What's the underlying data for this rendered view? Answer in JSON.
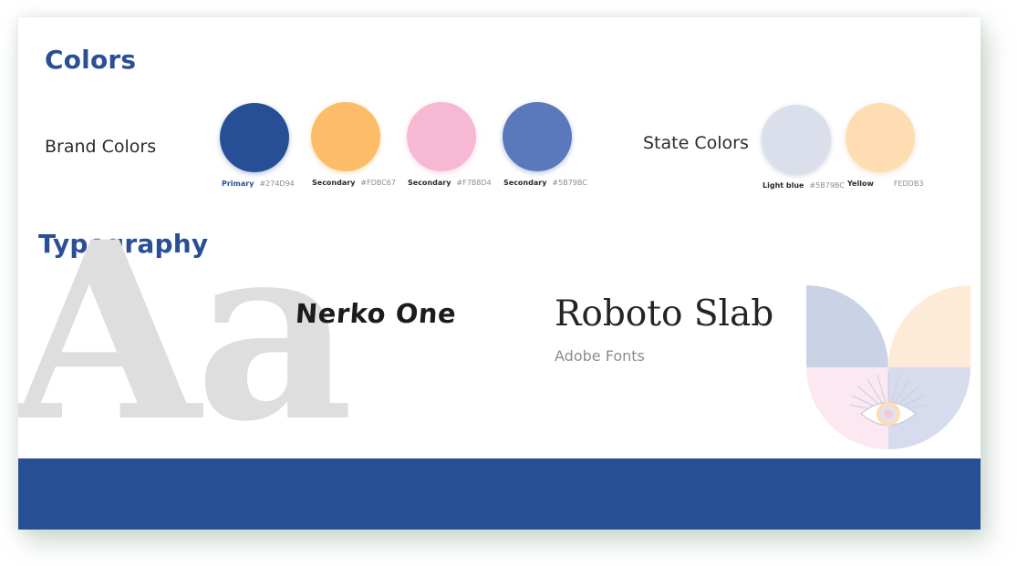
{
  "sections": {
    "colors_title": "Colors",
    "typography_title": "Typography"
  },
  "brand": {
    "label": "Brand Colors",
    "swatches": [
      {
        "name": "Primary",
        "code": "#274D94",
        "color": "#274f95"
      },
      {
        "name": "Secondary",
        "code": "#FDBC67",
        "color": "#fdbd68"
      },
      {
        "name": "Secondary",
        "code": "#F7B8D4",
        "color": "#f7b8d4"
      },
      {
        "name": "Secondary",
        "code": "#5B79BC",
        "color": "#5a79bd"
      }
    ]
  },
  "state": {
    "label": "State Colors",
    "swatches": [
      {
        "name": "Light blue",
        "code": "#5B79BC",
        "color": "#dadfeb"
      },
      {
        "name": "Yellow",
        "code": "FEDDB3",
        "color": "#feddb2"
      }
    ]
  },
  "typography": {
    "specimen": "Aa",
    "font1": "Nerko One",
    "font2": "Roboto Slab",
    "font2_source": "Adobe Fonts"
  },
  "colors": {
    "heading": "#2a4f97",
    "footer": "#274f95",
    "illus_blue": "#cad2e6",
    "illus_peach": "#fdebd7",
    "illus_pink": "#fbe8f0",
    "illus_lavender": "#d6dced"
  }
}
